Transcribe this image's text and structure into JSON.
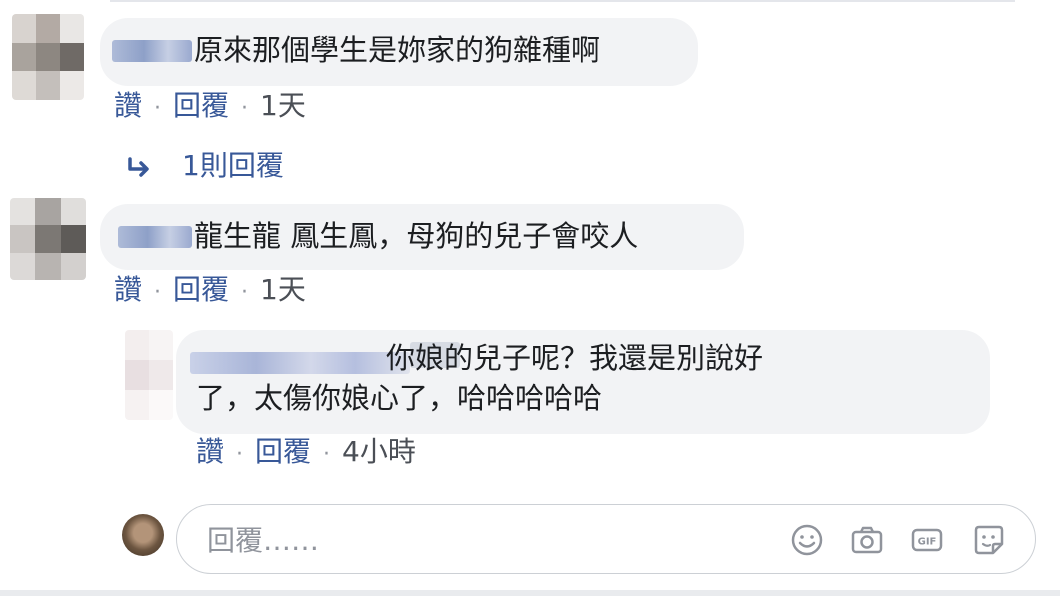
{
  "comments": [
    {
      "text": "原來那個學生是妳家的狗雜種啊",
      "actions": {
        "like": "讚",
        "reply": "回覆",
        "time": "1天"
      },
      "replies_link": "1則回覆"
    },
    {
      "text": "龍生龍 鳳生鳳，母狗的兒子會咬人",
      "actions": {
        "like": "讚",
        "reply": "回覆",
        "time": "1天"
      },
      "reply": {
        "text_line1": "你娘的兒子呢？我還是別說好",
        "text_line2": "了，太傷你娘心了，哈哈哈哈哈",
        "actions": {
          "like": "讚",
          "reply": "回覆",
          "time": "4小時"
        }
      }
    }
  ],
  "composer": {
    "placeholder": "回覆……",
    "icons": [
      "emoji-icon",
      "camera-icon",
      "gif-icon",
      "sticker-icon"
    ]
  },
  "colors": {
    "bubble": "#f2f3f5",
    "link": "#385898",
    "meta": "#90949c"
  }
}
